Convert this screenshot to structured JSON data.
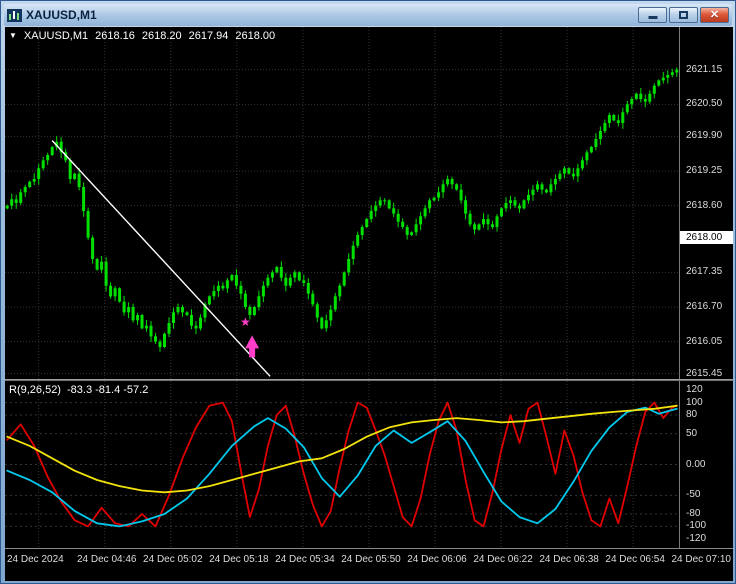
{
  "window": {
    "title": "XAUUSD,M1",
    "close_glyph": "✕"
  },
  "quote": {
    "marker_glyph": "▼",
    "symbol": "XAUUSD,M1",
    "open": "2618.16",
    "high": "2618.20",
    "low": "2617.94",
    "close": "2618.00"
  },
  "price_axis": {
    "labels": [
      {
        "text": "2621.15",
        "value": 2621.15
      },
      {
        "text": "2620.50",
        "value": 2620.5
      },
      {
        "text": "2619.90",
        "value": 2619.9
      },
      {
        "text": "2619.25",
        "value": 2619.25
      },
      {
        "text": "2618.60",
        "value": 2618.6
      },
      {
        "text": "2617.35",
        "value": 2617.35
      },
      {
        "text": "2616.70",
        "value": 2616.7
      },
      {
        "text": "2616.05",
        "value": 2616.05
      },
      {
        "text": "2615.45",
        "value": 2615.45
      }
    ],
    "current": {
      "text": "2618.00",
      "value": 2618.0
    }
  },
  "indicator": {
    "title": "R(9,26,52)",
    "values_text": "-83.3 -81.4 -57.2",
    "axis": [
      {
        "text": "120",
        "value": 120
      },
      {
        "text": "100",
        "value": 100
      },
      {
        "text": "80",
        "value": 80
      },
      {
        "text": "50",
        "value": 50
      },
      {
        "text": "0.00",
        "value": 0
      },
      {
        "text": "-50",
        "value": -50
      },
      {
        "text": "-80",
        "value": -80
      },
      {
        "text": "-100",
        "value": -100
      },
      {
        "text": "-120",
        "value": -120
      }
    ]
  },
  "time_axis": {
    "labels": [
      "24 Dec 2024",
      "24 Dec 04:46",
      "24 Dec 05:02",
      "24 Dec 05:18",
      "24 Dec 05:34",
      "24 Dec 05:50",
      "24 Dec 06:06",
      "24 Dec 06:22",
      "24 Dec 06:38",
      "24 Dec 06:54",
      "24 Dec 07:10"
    ],
    "ticks": {
      "first_bar": 7,
      "step_bars": 14.7
    }
  },
  "chart_data": {
    "type": "candlestick",
    "symbol": "XAUUSD",
    "timeframe": "M1",
    "price_range": {
      "top": 2621.95,
      "bottom": 2615.35
    },
    "grid_prices": [
      2621.15,
      2620.5,
      2619.9,
      2619.25,
      2618.6,
      2617.35,
      2616.7,
      2616.05,
      2615.45
    ],
    "closes": [
      2618.6,
      2618.72,
      2618.65,
      2618.85,
      2618.95,
      2619.05,
      2619.1,
      2619.3,
      2619.45,
      2619.55,
      2619.7,
      2619.8,
      2619.6,
      2619.45,
      2619.1,
      2619.2,
      2618.95,
      2618.5,
      2618.0,
      2617.6,
      2617.4,
      2617.55,
      2617.1,
      2616.9,
      2617.05,
      2616.8,
      2616.6,
      2616.7,
      2616.45,
      2616.55,
      2616.3,
      2616.35,
      2616.15,
      2616.05,
      2615.95,
      2616.2,
      2616.4,
      2616.6,
      2616.7,
      2616.6,
      2616.55,
      2616.35,
      2616.3,
      2616.5,
      2616.75,
      2616.9,
      2617.0,
      2617.1,
      2617.05,
      2617.2,
      2617.3,
      2617.1,
      2616.95,
      2616.7,
      2616.55,
      2616.7,
      2616.9,
      2617.1,
      2617.25,
      2617.35,
      2617.45,
      2617.25,
      2617.1,
      2617.25,
      2617.35,
      2617.2,
      2617.15,
      2616.95,
      2616.75,
      2616.5,
      2616.3,
      2616.45,
      2616.65,
      2616.9,
      2617.1,
      2617.35,
      2617.6,
      2617.85,
      2618.05,
      2618.2,
      2618.35,
      2618.5,
      2618.6,
      2618.7,
      2618.7,
      2618.55,
      2618.45,
      2618.3,
      2618.2,
      2618.05,
      2618.1,
      2618.25,
      2618.4,
      2618.55,
      2618.7,
      2618.75,
      2618.85,
      2619.0,
      2619.1,
      2619.0,
      2618.9,
      2618.7,
      2618.45,
      2618.25,
      2618.15,
      2618.25,
      2618.35,
      2618.25,
      2618.2,
      2618.4,
      2618.55,
      2618.65,
      2618.7,
      2618.6,
      2618.55,
      2618.7,
      2618.8,
      2618.9,
      2619.0,
      2618.9,
      2618.85,
      2619.0,
      2619.1,
      2619.2,
      2619.3,
      2619.2,
      2619.15,
      2619.3,
      2619.45,
      2619.6,
      2619.7,
      2619.85,
      2620.0,
      2620.15,
      2620.3,
      2620.2,
      2620.15,
      2620.35,
      2620.5,
      2620.6,
      2620.7,
      2620.6,
      2620.55,
      2620.7,
      2620.85,
      2620.95,
      2621.0,
      2621.05,
      2621.1,
      2621.15
    ],
    "special_wicks": {
      "11": {
        "high": 2619.88
      },
      "34": {
        "low": 2615.86
      }
    },
    "trendline": {
      "from_bar": 10,
      "from_price": 2619.82,
      "to_bar": 58.5,
      "to_price": 2615.4,
      "color": "#ffffff"
    },
    "markers": [
      {
        "type": "star",
        "glyph": "★",
        "bar": 53,
        "price": 2616.42,
        "color": "#ff3dc9"
      },
      {
        "type": "arrow-up",
        "bar": 54.5,
        "price": 2615.98,
        "color": "#ff3dc9"
      }
    ],
    "oscillator": {
      "label": "R(9,26,52)",
      "current_values": [
        -83.3,
        -81.4,
        -57.2
      ],
      "range": {
        "top": 135,
        "bottom": -135
      },
      "grid_values": [
        100,
        80,
        50,
        0,
        -50,
        -80,
        -100
      ],
      "series": [
        {
          "name": "fast-red",
          "color": "#e10000",
          "points": [
            [
              0,
              40
            ],
            [
              3,
              65
            ],
            [
              6,
              30
            ],
            [
              9,
              -20
            ],
            [
              12,
              -60
            ],
            [
              15,
              -90
            ],
            [
              18,
              -100
            ],
            [
              21,
              -70
            ],
            [
              24,
              -95
            ],
            [
              27,
              -100
            ],
            [
              30,
              -80
            ],
            [
              33,
              -100
            ],
            [
              36,
              -50
            ],
            [
              39,
              10
            ],
            [
              42,
              60
            ],
            [
              45,
              95
            ],
            [
              48,
              100
            ],
            [
              50,
              70
            ],
            [
              52,
              -10
            ],
            [
              54,
              -85
            ],
            [
              56,
              -40
            ],
            [
              58,
              30
            ],
            [
              60,
              80
            ],
            [
              62,
              95
            ],
            [
              64,
              45
            ],
            [
              66,
              -15
            ],
            [
              68,
              -65
            ],
            [
              70,
              -100
            ],
            [
              72,
              -75
            ],
            [
              74,
              -5
            ],
            [
              76,
              55
            ],
            [
              78,
              100
            ],
            [
              80,
              92
            ],
            [
              82,
              55
            ],
            [
              84,
              15
            ],
            [
              86,
              -35
            ],
            [
              88,
              -85
            ],
            [
              90,
              -100
            ],
            [
              92,
              -55
            ],
            [
              94,
              15
            ],
            [
              96,
              70
            ],
            [
              98,
              100
            ],
            [
              100,
              55
            ],
            [
              102,
              -25
            ],
            [
              104,
              -90
            ],
            [
              106,
              -100
            ],
            [
              108,
              -45
            ],
            [
              110,
              25
            ],
            [
              112,
              80
            ],
            [
              114,
              35
            ],
            [
              116,
              90
            ],
            [
              118,
              100
            ],
            [
              120,
              45
            ],
            [
              122,
              -15
            ],
            [
              124,
              55
            ],
            [
              126,
              15
            ],
            [
              128,
              -45
            ],
            [
              130,
              -90
            ],
            [
              132,
              -100
            ],
            [
              134,
              -55
            ],
            [
              136,
              -95
            ],
            [
              138,
              -35
            ],
            [
              140,
              30
            ],
            [
              142,
              85
            ],
            [
              144,
              100
            ],
            [
              146,
              75
            ],
            [
              148,
              92
            ],
            [
              149,
              95
            ]
          ]
        },
        {
          "name": "mid-cyan",
          "color": "#00c9ee",
          "points": [
            [
              0,
              -10
            ],
            [
              5,
              -25
            ],
            [
              10,
              -45
            ],
            [
              15,
              -75
            ],
            [
              20,
              -95
            ],
            [
              25,
              -100
            ],
            [
              30,
              -92
            ],
            [
              35,
              -80
            ],
            [
              40,
              -55
            ],
            [
              45,
              -15
            ],
            [
              50,
              30
            ],
            [
              55,
              62
            ],
            [
              58,
              75
            ],
            [
              62,
              58
            ],
            [
              66,
              28
            ],
            [
              70,
              -22
            ],
            [
              74,
              -52
            ],
            [
              78,
              -18
            ],
            [
              82,
              30
            ],
            [
              86,
              55
            ],
            [
              90,
              35
            ],
            [
              94,
              52
            ],
            [
              98,
              70
            ],
            [
              102,
              38
            ],
            [
              106,
              -12
            ],
            [
              110,
              -60
            ],
            [
              114,
              -85
            ],
            [
              118,
              -95
            ],
            [
              122,
              -72
            ],
            [
              126,
              -28
            ],
            [
              130,
              22
            ],
            [
              134,
              60
            ],
            [
              138,
              85
            ],
            [
              142,
              92
            ],
            [
              145,
              82
            ],
            [
              147,
              86
            ],
            [
              149,
              90
            ]
          ]
        },
        {
          "name": "slow-yellow",
          "color": "#f2e30c",
          "points": [
            [
              0,
              45
            ],
            [
              5,
              30
            ],
            [
              10,
              10
            ],
            [
              15,
              -10
            ],
            [
              20,
              -25
            ],
            [
              25,
              -35
            ],
            [
              30,
              -42
            ],
            [
              35,
              -45
            ],
            [
              40,
              -42
            ],
            [
              45,
              -35
            ],
            [
              50,
              -25
            ],
            [
              55,
              -15
            ],
            [
              60,
              -5
            ],
            [
              65,
              5
            ],
            [
              70,
              10
            ],
            [
              75,
              25
            ],
            [
              80,
              45
            ],
            [
              85,
              60
            ],
            [
              90,
              68
            ],
            [
              95,
              72
            ],
            [
              100,
              75
            ],
            [
              105,
              72
            ],
            [
              110,
              68
            ],
            [
              115,
              70
            ],
            [
              120,
              74
            ],
            [
              125,
              78
            ],
            [
              130,
              82
            ],
            [
              135,
              85
            ],
            [
              140,
              88
            ],
            [
              144,
              90
            ],
            [
              147,
              93
            ],
            [
              149,
              95
            ]
          ]
        }
      ]
    },
    "colors": {
      "candle": "#00e000",
      "grid": "#343434",
      "background": "#000000",
      "axis_text": "#dcdcdc"
    }
  }
}
